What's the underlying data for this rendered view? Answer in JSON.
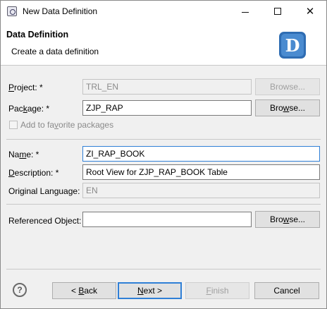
{
  "window": {
    "title": "New Data Definition",
    "controls": {
      "minimize": "minimize",
      "maximize": "maximize",
      "close": "✕"
    }
  },
  "banner": {
    "title": "Data Definition",
    "subtitle": "Create a data definition",
    "logo_letter": "D",
    "logo_color": "#2f6db3"
  },
  "form": {
    "project": {
      "label_pre": "P",
      "label_rest": "roject: *",
      "value": "TRL_EN",
      "browse": "Browse..."
    },
    "package": {
      "label_pre": "Pac",
      "label_u": "k",
      "label_rest": "age: *",
      "value": "ZJP_RAP",
      "browse_pre": "Bro",
      "browse_u": "w",
      "browse_rest": "se..."
    },
    "favorite": {
      "label_pre": "Add to fa",
      "label_u": "v",
      "label_rest": "orite packages",
      "checked": false
    },
    "name": {
      "label_pre": "Na",
      "label_u": "m",
      "label_rest": "e: *",
      "value": "ZI_RAP_BOOK"
    },
    "description": {
      "label_u": "D",
      "label_rest": "escription: *",
      "value": "Root View for ZJP_RAP_BOOK Table"
    },
    "original_language": {
      "label": "Original Language:",
      "value": "EN"
    },
    "referenced_object": {
      "label": "Referenced Object:",
      "value": "",
      "browse_pre": "Bro",
      "browse_u": "w",
      "browse_rest": "se..."
    }
  },
  "footer": {
    "help": "?",
    "back_pre": "< ",
    "back_u": "B",
    "back_rest": "ack",
    "next_u": "N",
    "next_rest": "ext >",
    "finish_u": "F",
    "finish_rest": "inish",
    "cancel": "Cancel"
  },
  "colors": {
    "accent": "#2f7fd6"
  }
}
